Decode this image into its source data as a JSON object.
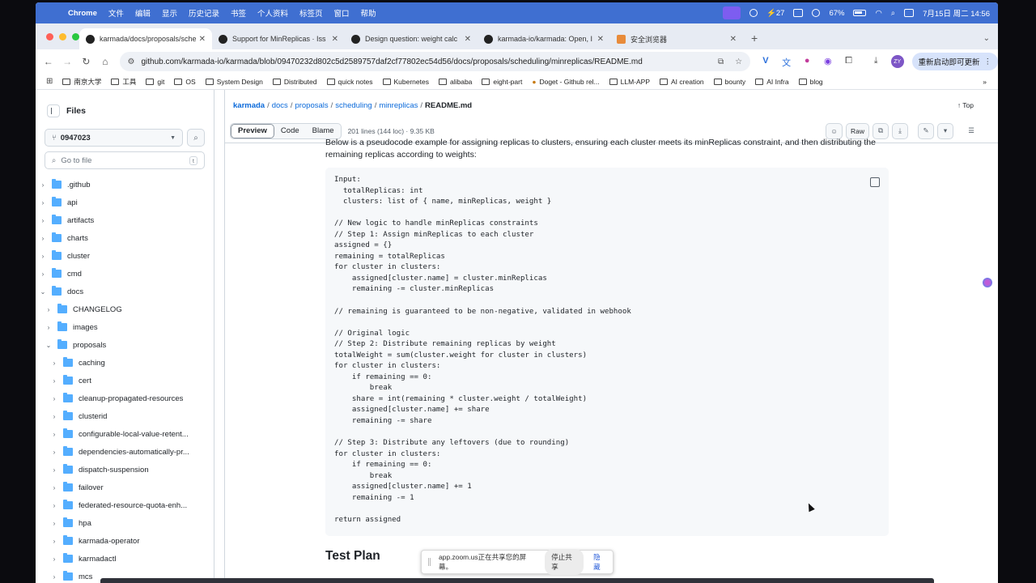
{
  "menubar": {
    "app": "Chrome",
    "items": [
      "文件",
      "编辑",
      "显示",
      "历史记录",
      "书签",
      "个人资料",
      "标签页",
      "窗口",
      "帮助"
    ],
    "badge": "27",
    "battery": "67%",
    "datetime": "7月15日 周二  14:56"
  },
  "tabs": [
    {
      "title": "karmada/docs/proposals/sche",
      "active": true
    },
    {
      "title": "Support for MinReplicas · Iss",
      "active": false
    },
    {
      "title": "Design question: weight calc",
      "active": false
    },
    {
      "title": "karmada-io/karmada: Open, I",
      "active": false
    },
    {
      "title": "安全浏览器",
      "active": false
    }
  ],
  "address": {
    "url": "github.com/karmada-io/karmada/blob/09470232d802c5d2589757daf2cf77802ec54d56/docs/proposals/scheduling/minreplicas/README.md",
    "avatar": "ZY",
    "update_label": "重新启动即可更新"
  },
  "bookmarks": [
    "南京大学",
    "工具",
    "git",
    "OS",
    "System Design",
    "Distributed",
    "quick notes",
    "Kubernetes",
    "alibaba",
    "eight-part",
    "Doget - Github rel...",
    "LLM-APP",
    "AI creation",
    "bounty",
    "AI Infra",
    "blog"
  ],
  "sidebar": {
    "title": "Files",
    "branch": "0947023",
    "search_placeholder": "Go to file",
    "search_kbd": "t",
    "tree": [
      {
        "name": ".github",
        "level": 0,
        "open": false
      },
      {
        "name": "api",
        "level": 0,
        "open": false
      },
      {
        "name": "artifacts",
        "level": 0,
        "open": false
      },
      {
        "name": "charts",
        "level": 0,
        "open": false
      },
      {
        "name": "cluster",
        "level": 0,
        "open": false
      },
      {
        "name": "cmd",
        "level": 0,
        "open": false
      },
      {
        "name": "docs",
        "level": 0,
        "open": true
      },
      {
        "name": "CHANGELOG",
        "level": 1,
        "open": false
      },
      {
        "name": "images",
        "level": 1,
        "open": false
      },
      {
        "name": "proposals",
        "level": 1,
        "open": true
      },
      {
        "name": "caching",
        "level": 2,
        "open": false
      },
      {
        "name": "cert",
        "level": 2,
        "open": false
      },
      {
        "name": "cleanup-propagated-resources",
        "level": 2,
        "open": false
      },
      {
        "name": "clusterid",
        "level": 2,
        "open": false
      },
      {
        "name": "configurable-local-value-retent...",
        "level": 2,
        "open": false
      },
      {
        "name": "dependencies-automatically-pr...",
        "level": 2,
        "open": false
      },
      {
        "name": "dispatch-suspension",
        "level": 2,
        "open": false
      },
      {
        "name": "failover",
        "level": 2,
        "open": false
      },
      {
        "name": "federated-resource-quota-enh...",
        "level": 2,
        "open": false
      },
      {
        "name": "hpa",
        "level": 2,
        "open": false
      },
      {
        "name": "karmada-operator",
        "level": 2,
        "open": false
      },
      {
        "name": "karmadactl",
        "level": 2,
        "open": false
      },
      {
        "name": "mcs",
        "level": 2,
        "open": false
      }
    ]
  },
  "breadcrumb": {
    "repo": "karmada",
    "parts": [
      "docs",
      "proposals",
      "scheduling",
      "minreplicas"
    ],
    "current": "README.md",
    "top_label": "Top"
  },
  "filebar": {
    "tabs": [
      "Preview",
      "Code",
      "Blame"
    ],
    "active_tab": "Preview",
    "info": "201 lines (144 loc) · 9.35 KB",
    "raw_label": "Raw"
  },
  "content": {
    "intro": "Below is a pseudocode example for assigning replicas to clusters, ensuring each cluster meets its minReplicas constraint, and then distributing the remaining replicas according to weights:",
    "code": "Input:\n  totalReplicas: int\n  clusters: list of { name, minReplicas, weight }\n\n// New logic to handle minReplicas constraints\n// Step 1: Assign minReplicas to each cluster\nassigned = {}\nremaining = totalReplicas\nfor cluster in clusters:\n    assigned[cluster.name] = cluster.minReplicas\n    remaining -= cluster.minReplicas\n\n// remaining is guaranteed to be non-negative, validated in webhook\n\n// Original logic\n// Step 2: Distribute remaining replicas by weight\ntotalWeight = sum(cluster.weight for cluster in clusters)\nfor cluster in clusters:\n    if remaining == 0:\n        break\n    share = int(remaining * cluster.weight / totalWeight)\n    assigned[cluster.name] += share\n    remaining -= share\n\n// Step 3: Distribute any leftovers (due to rounding)\nfor cluster in clusters:\n    if remaining == 0:\n        break\n    assigned[cluster.name] += 1\n    remaining -= 1\n\nreturn assigned",
    "next_heading": "Test Plan"
  },
  "zoom_share": {
    "text": "app.zoom.us正在共享您的屏幕。",
    "stop_label": "停止共享",
    "hide_label": "隐藏"
  },
  "colors": {
    "menubar": "#3f6fd1",
    "link": "#0969da",
    "folder": "#54aeff"
  }
}
